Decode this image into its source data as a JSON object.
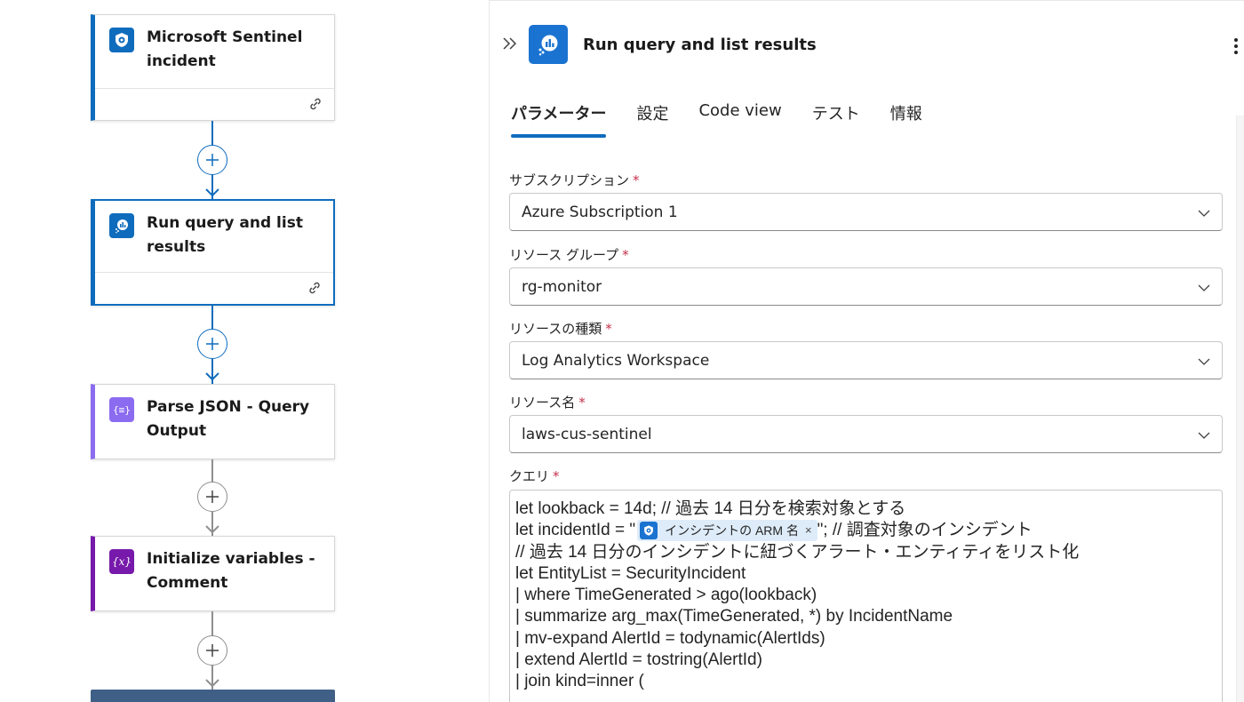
{
  "flow": {
    "cards": [
      {
        "title": "Microsoft Sentinel incident",
        "icon": "sentinel-shield-icon",
        "color": "#0f6cbd"
      },
      {
        "title": "Run query and list results",
        "icon": "log-analytics-icon",
        "color": "#0f6cbd"
      },
      {
        "title": "Parse JSON - Query Output",
        "icon": "parse-json-icon",
        "color": "#8b6cf0"
      },
      {
        "title": "Initialize variables - Comment",
        "icon": "variable-icon",
        "color": "#7719aa"
      }
    ]
  },
  "panel": {
    "title": "Run query and list results",
    "tabs": [
      "パラメーター",
      "設定",
      "Code view",
      "テスト",
      "情報"
    ],
    "active_tab": "パラメーター",
    "fields": {
      "subscription": {
        "label": "サブスクリプション",
        "value": "Azure Subscription 1"
      },
      "resource_group": {
        "label": "リソース グループ",
        "value": "rg-monitor"
      },
      "resource_type": {
        "label": "リソースの種類",
        "value": "Log Analytics Workspace"
      },
      "resource_name": {
        "label": "リソース名",
        "value": "laws-cus-sentinel"
      },
      "query": {
        "label": "クエリ"
      }
    },
    "required_mark": "*",
    "query_lines": {
      "l1": "let lookback = 14d; // 過去 14 日分を検索対象とする",
      "l2_pre": "let incidentId = \"",
      "token": "インシデントの ARM 名",
      "token_close": "×",
      "l2_post": "\"; // 調査対象のインシデント",
      "l3": "// 過去 14 日分のインシデントに紐づくアラート・エンティティをリスト化",
      "l4": "let EntityList = SecurityIncident",
      "l5": "| where TimeGenerated > ago(lookback)",
      "l6": "| summarize arg_max(TimeGenerated, *) by IncidentName",
      "l7": "| mv-expand AlertId = todynamic(AlertIds)",
      "l8": "| extend AlertId = tostring(AlertId)",
      "l9": "| join kind=inner ("
    }
  }
}
